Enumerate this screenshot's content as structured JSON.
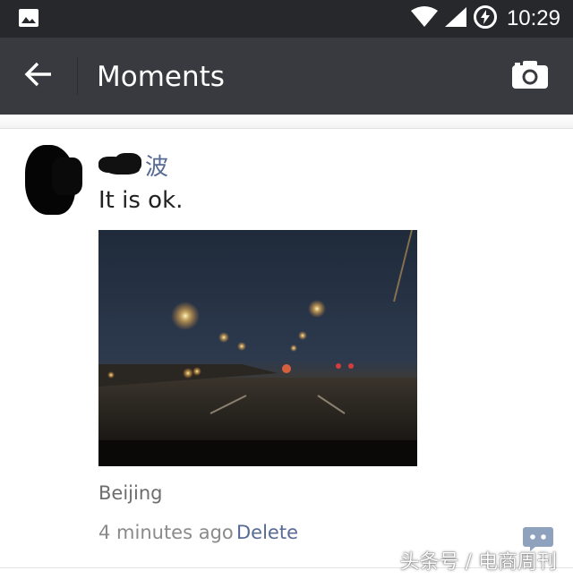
{
  "status_bar": {
    "time": "10:29",
    "icons": [
      "image-notification-icon",
      "wifi-icon",
      "signal-icon",
      "battery-charging-icon"
    ]
  },
  "app_bar": {
    "title": "Moments",
    "back_icon": "back-arrow-icon",
    "camera_icon": "camera-icon"
  },
  "post": {
    "name": "波",
    "text": "It is ok.",
    "location": "Beijing",
    "time_ago": "4 minutes ago",
    "delete_label": "Delete",
    "comment_icon": "comment-icon"
  },
  "watermark": "头条号 / 电商周刊",
  "colors": {
    "status_bar": "#26282c",
    "app_bar": "#393a3f",
    "link": "#576b95",
    "comment_icon": "#8ea1bd"
  }
}
